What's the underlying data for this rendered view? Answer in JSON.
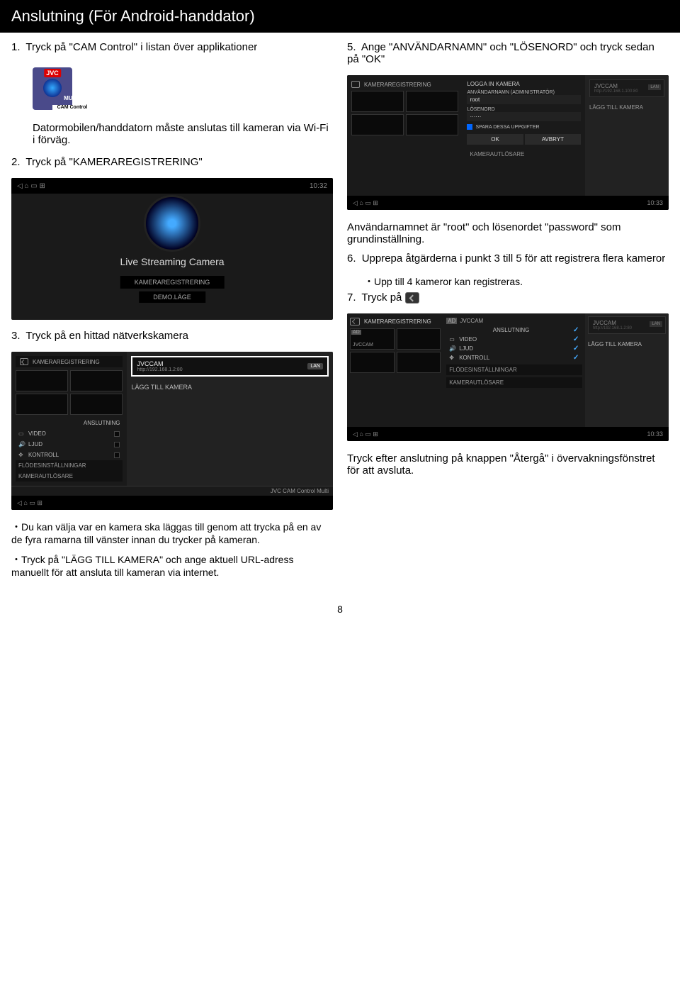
{
  "header": "Anslutning (För Android-handdator)",
  "step1": {
    "num": "1.",
    "text": "Tryck på \"CAM Control\" i listan över applikationer"
  },
  "appIcon": {
    "jvc": "JVC",
    "multi": "MULTI",
    "cam": "CAM Control"
  },
  "note1": "Datormobilen/handdatorn måste anslutas till kameran via Wi-Fi i förväg.",
  "step2": {
    "num": "2.",
    "text": "Tryck på \"KAMERAREGISTRERING\""
  },
  "liveScreen": {
    "title": "Live Streaming Camera",
    "btn1": "KAMERAREGISTRERING",
    "btn2": "DEMO.LÄGE",
    "clock": "10:32"
  },
  "step3": {
    "num": "3.",
    "text": "Tryck på en hittad nätverkskamera"
  },
  "regScreen": {
    "hdr": "KAMERAREGISTRERING",
    "anslut": "ANSLUTNING",
    "video": "VIDEO",
    "ljud": "LJUD",
    "kontroll": "KONTROLL",
    "flodes": "FLÖDESINSTÄLLNINGAR",
    "kamutl": "KAMERAUTLÖSARE",
    "camName": "JVCCAM",
    "camUrl": "http://192.168.1.2:80",
    "lan": "LAN",
    "addBtn": "LÄGG TILL KAMERA",
    "taskbar": "JVC CAM Control Multi"
  },
  "bullets": {
    "b1": "・Du kan välja var en kamera ska läggas till genom att trycka på en av de fyra ramarna till vänster innan du trycker på kameran.",
    "b2": "・Tryck på \"LÄGG TILL KAMERA\" och ange aktuell URL-adress manuellt för att ansluta till kameran via internet."
  },
  "step5": {
    "num": "5.",
    "text": "Ange \"ANVÄNDARNAMN\" och \"LÖSENORD\" och tryck sedan på \"OK\""
  },
  "loginScreen": {
    "hdr": "KAMERAREGISTRERING",
    "dialogTitle": "LOGGA IN KAMERA",
    "userLabel": "ANVÄNDARNAMN (ADMINISTRATÖR)",
    "userVal": "root",
    "passLabel": "LÖSENORD",
    "passVal": "······",
    "save": "SPARA DESSA UPPGIFTER",
    "ok": "OK",
    "avbryt": "AVBRYT",
    "kamutl": "KAMERAUTLÖSARE",
    "camName": "JVCCAM",
    "camUrl": "http://192.168.1.100:80",
    "lan": "LAN",
    "addBtn": "LÄGG TILL KAMERA",
    "clock": "10:33"
  },
  "note2": "Användarnamnet är \"root\" och lösenordet \"password\" som grundinställning.",
  "step6": {
    "num": "6.",
    "text": "Upprepa åtgärderna i punkt 3 till 5 för att registrera flera kameror",
    "sub": "・Upp till 4 kameror kan registreras."
  },
  "step7": {
    "num": "7.",
    "text": "Tryck på"
  },
  "finalScreen": {
    "hdr": "KAMERAREGISTRERING",
    "jvccam": "JVCCAM",
    "ad": "AD",
    "anslut": "ANSLUTNING",
    "video": "VIDEO",
    "ljud": "LJUD",
    "kontroll": "KONTROLL",
    "flodes": "FLÖDESINSTÄLLNINGAR",
    "kamutl": "KAMERAUTLÖSARE",
    "camUrl": "http://192.168.1.2:80",
    "lan": "LAN",
    "addBtn": "LÄGG TILL KAMERA",
    "clock": "10:33"
  },
  "finalNote": "Tryck efter anslutning på knappen \"Återgå\" i övervakningsfönstret för att avsluta.",
  "pageNum": "8"
}
